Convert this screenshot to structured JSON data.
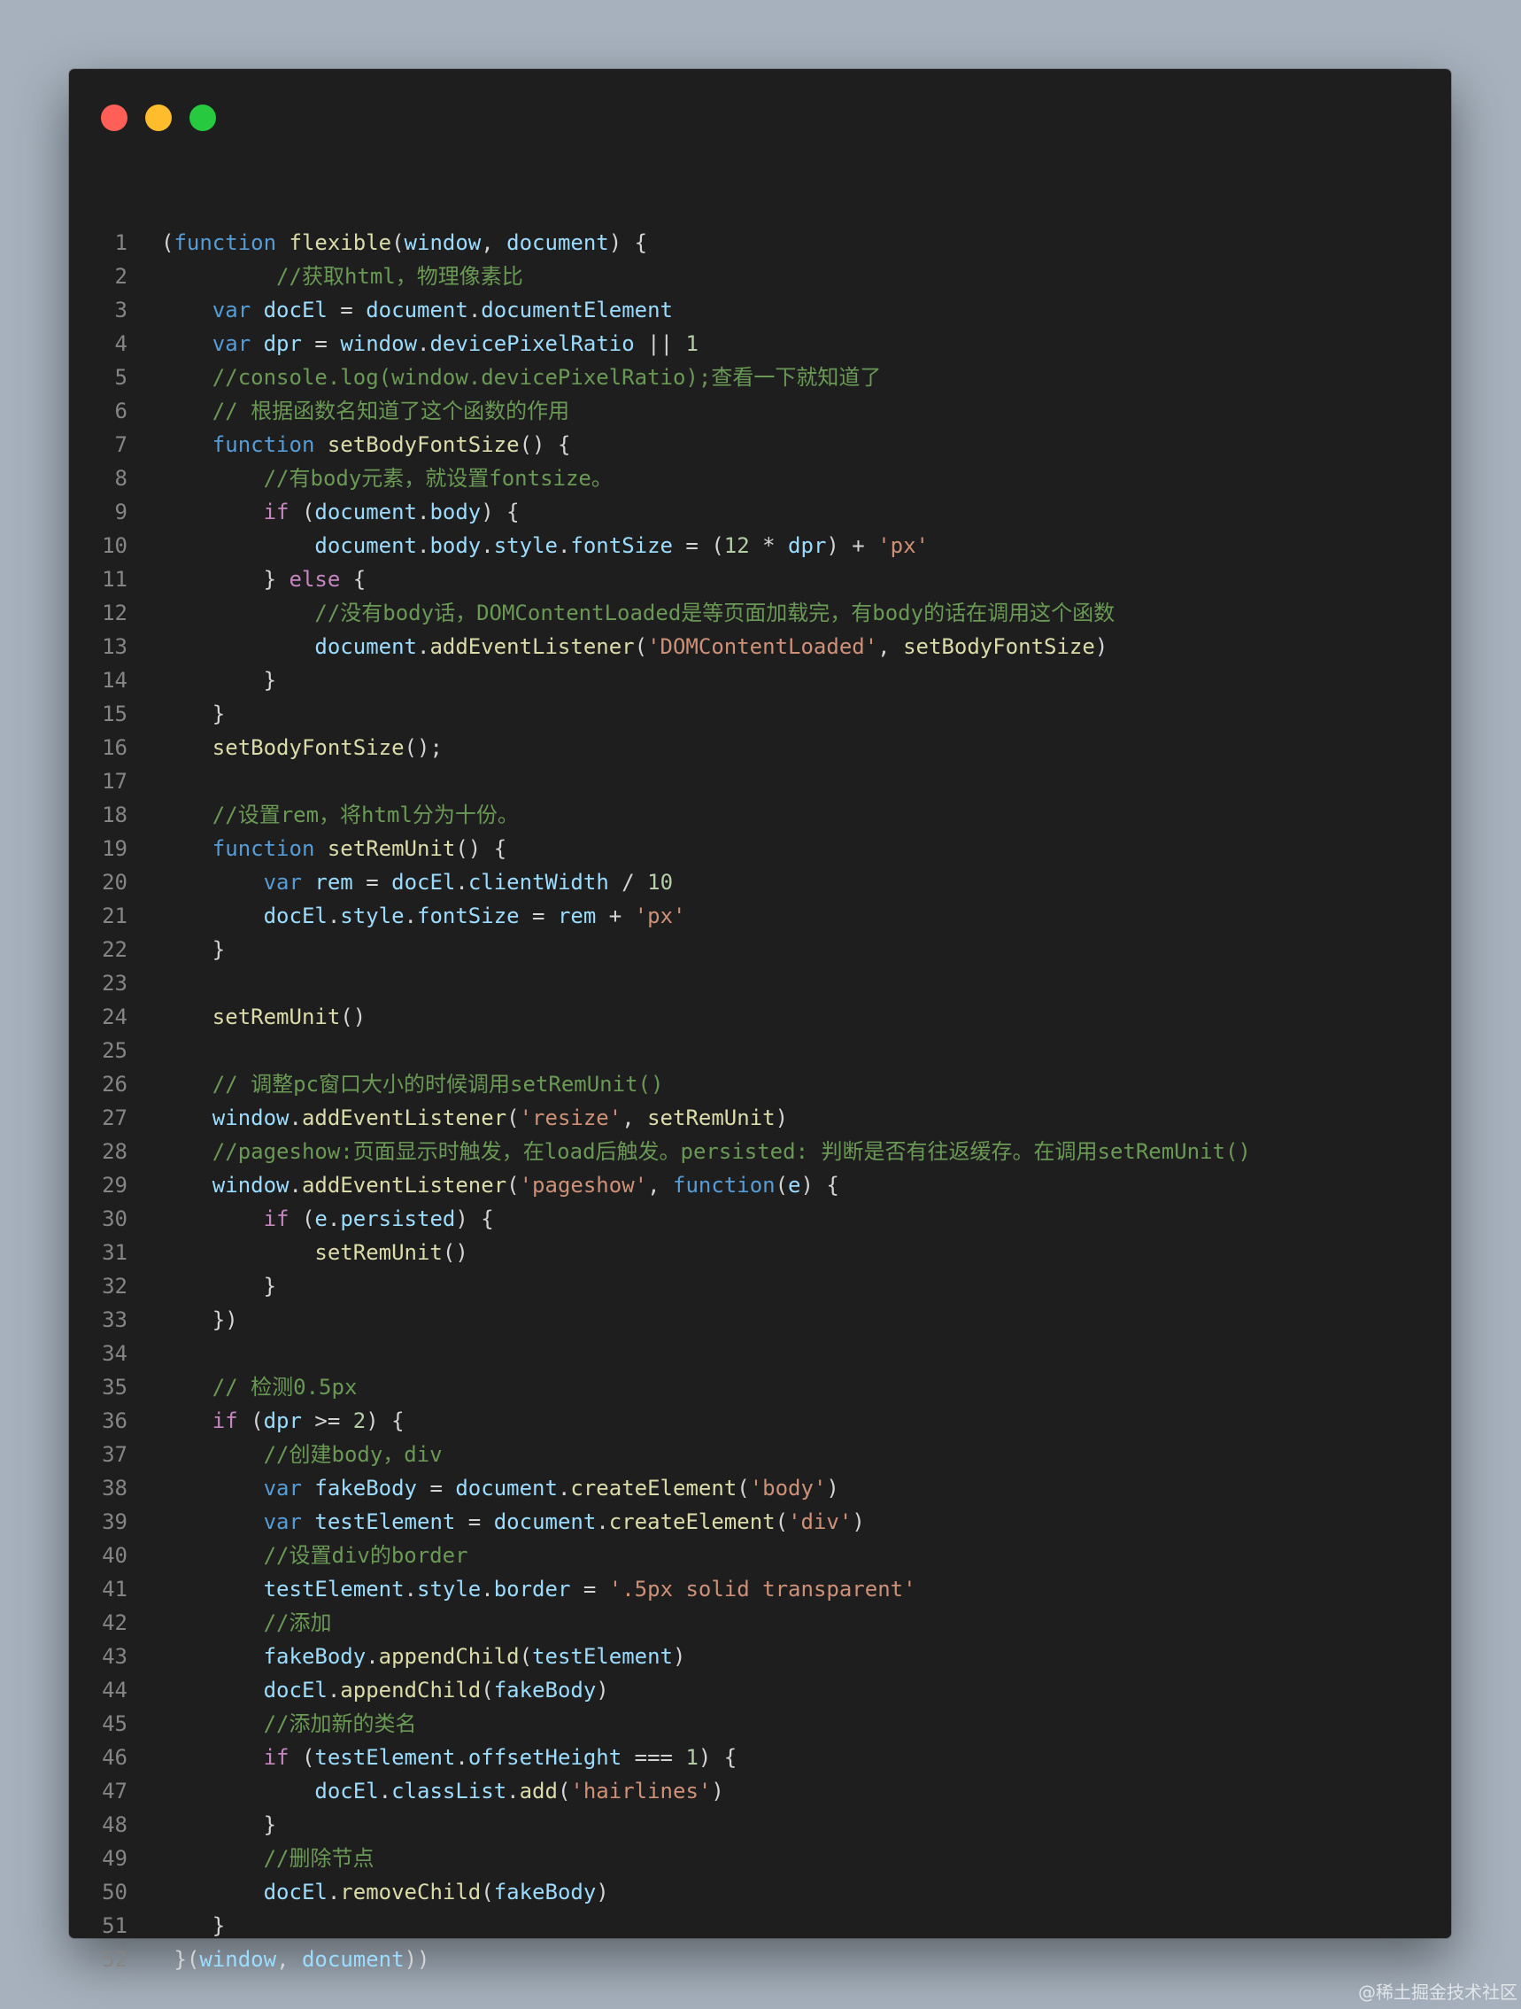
{
  "window": {
    "traffic_lights": [
      {
        "name": "close",
        "color": "#ff5f56"
      },
      {
        "name": "minimize",
        "color": "#ffbd2e"
      },
      {
        "name": "maximize",
        "color": "#27c93f"
      }
    ]
  },
  "code_lines": [
    [
      [
        "p",
        "("
      ],
      [
        "kw",
        "function"
      ],
      [
        "p",
        " "
      ],
      [
        "fn",
        "flexible"
      ],
      [
        "p",
        "("
      ],
      [
        "var",
        "window"
      ],
      [
        "p",
        ", "
      ],
      [
        "var",
        "document"
      ],
      [
        "p",
        ") {"
      ]
    ],
    [
      [
        "p",
        "         "
      ],
      [
        "cmt",
        "//获取html，物理像素比"
      ]
    ],
    [
      [
        "p",
        "    "
      ],
      [
        "kw",
        "var"
      ],
      [
        "p",
        " "
      ],
      [
        "var",
        "docEl"
      ],
      [
        "p",
        " = "
      ],
      [
        "var",
        "document"
      ],
      [
        "p",
        "."
      ],
      [
        "var",
        "documentElement"
      ]
    ],
    [
      [
        "p",
        "    "
      ],
      [
        "kw",
        "var"
      ],
      [
        "p",
        " "
      ],
      [
        "var",
        "dpr"
      ],
      [
        "p",
        " = "
      ],
      [
        "var",
        "window"
      ],
      [
        "p",
        "."
      ],
      [
        "var",
        "devicePixelRatio"
      ],
      [
        "p",
        " || "
      ],
      [
        "num",
        "1"
      ]
    ],
    [
      [
        "p",
        "    "
      ],
      [
        "cmt",
        "//console.log(window.devicePixelRatio);查看一下就知道了"
      ]
    ],
    [
      [
        "p",
        "    "
      ],
      [
        "cmt",
        "// 根据函数名知道了这个函数的作用"
      ]
    ],
    [
      [
        "p",
        "    "
      ],
      [
        "kw",
        "function"
      ],
      [
        "p",
        " "
      ],
      [
        "fn",
        "setBodyFontSize"
      ],
      [
        "p",
        "() {"
      ]
    ],
    [
      [
        "p",
        "        "
      ],
      [
        "cmt",
        "//有body元素，就设置fontsize。"
      ]
    ],
    [
      [
        "p",
        "        "
      ],
      [
        "ctl",
        "if"
      ],
      [
        "p",
        " ("
      ],
      [
        "var",
        "document"
      ],
      [
        "p",
        "."
      ],
      [
        "var",
        "body"
      ],
      [
        "p",
        ") {"
      ]
    ],
    [
      [
        "p",
        "            "
      ],
      [
        "var",
        "document"
      ],
      [
        "p",
        "."
      ],
      [
        "var",
        "body"
      ],
      [
        "p",
        "."
      ],
      [
        "var",
        "style"
      ],
      [
        "p",
        "."
      ],
      [
        "var",
        "fontSize"
      ],
      [
        "p",
        " = ("
      ],
      [
        "num",
        "12"
      ],
      [
        "p",
        " * "
      ],
      [
        "var",
        "dpr"
      ],
      [
        "p",
        ") + "
      ],
      [
        "str",
        "'px'"
      ]
    ],
    [
      [
        "p",
        "        } "
      ],
      [
        "ctl",
        "else"
      ],
      [
        "p",
        " {"
      ]
    ],
    [
      [
        "p",
        "            "
      ],
      [
        "cmt",
        "//没有body话，DOMContentLoaded是等页面加载完，有body的话在调用这个函数"
      ]
    ],
    [
      [
        "p",
        "            "
      ],
      [
        "var",
        "document"
      ],
      [
        "p",
        "."
      ],
      [
        "fn",
        "addEventListener"
      ],
      [
        "p",
        "("
      ],
      [
        "str",
        "'DOMContentLoaded'"
      ],
      [
        "p",
        ", "
      ],
      [
        "fn",
        "setBodyFontSize"
      ],
      [
        "p",
        ")"
      ]
    ],
    [
      [
        "p",
        "        }"
      ]
    ],
    [
      [
        "p",
        "    }"
      ]
    ],
    [
      [
        "p",
        "    "
      ],
      [
        "fn",
        "setBodyFontSize"
      ],
      [
        "p",
        "();"
      ]
    ],
    [],
    [
      [
        "p",
        "    "
      ],
      [
        "cmt",
        "//设置rem，将html分为十份。"
      ]
    ],
    [
      [
        "p",
        "    "
      ],
      [
        "kw",
        "function"
      ],
      [
        "p",
        " "
      ],
      [
        "fn",
        "setRemUnit"
      ],
      [
        "p",
        "() {"
      ]
    ],
    [
      [
        "p",
        "        "
      ],
      [
        "kw",
        "var"
      ],
      [
        "p",
        " "
      ],
      [
        "var",
        "rem"
      ],
      [
        "p",
        " = "
      ],
      [
        "var",
        "docEl"
      ],
      [
        "p",
        "."
      ],
      [
        "var",
        "clientWidth"
      ],
      [
        "p",
        " / "
      ],
      [
        "num",
        "10"
      ]
    ],
    [
      [
        "p",
        "        "
      ],
      [
        "var",
        "docEl"
      ],
      [
        "p",
        "."
      ],
      [
        "var",
        "style"
      ],
      [
        "p",
        "."
      ],
      [
        "var",
        "fontSize"
      ],
      [
        "p",
        " = "
      ],
      [
        "var",
        "rem"
      ],
      [
        "p",
        " + "
      ],
      [
        "str",
        "'px'"
      ]
    ],
    [
      [
        "p",
        "    }"
      ]
    ],
    [],
    [
      [
        "p",
        "    "
      ],
      [
        "fn",
        "setRemUnit"
      ],
      [
        "p",
        "()"
      ]
    ],
    [],
    [
      [
        "p",
        "    "
      ],
      [
        "cmt",
        "// 调整pc窗口大小的时候调用setRemUnit()"
      ]
    ],
    [
      [
        "p",
        "    "
      ],
      [
        "var",
        "window"
      ],
      [
        "p",
        "."
      ],
      [
        "fn",
        "addEventListener"
      ],
      [
        "p",
        "("
      ],
      [
        "str",
        "'resize'"
      ],
      [
        "p",
        ", "
      ],
      [
        "fn",
        "setRemUnit"
      ],
      [
        "p",
        ")"
      ]
    ],
    [
      [
        "p",
        "    "
      ],
      [
        "cmt",
        "//pageshow:页面显示时触发，在load后触发。persisted: 判断是否有往返缓存。在调用setRemUnit()"
      ]
    ],
    [
      [
        "p",
        "    "
      ],
      [
        "var",
        "window"
      ],
      [
        "p",
        "."
      ],
      [
        "fn",
        "addEventListener"
      ],
      [
        "p",
        "("
      ],
      [
        "str",
        "'pageshow'"
      ],
      [
        "p",
        ", "
      ],
      [
        "kw",
        "function"
      ],
      [
        "p",
        "("
      ],
      [
        "var",
        "e"
      ],
      [
        "p",
        ") {"
      ]
    ],
    [
      [
        "p",
        "        "
      ],
      [
        "ctl",
        "if"
      ],
      [
        "p",
        " ("
      ],
      [
        "var",
        "e"
      ],
      [
        "p",
        "."
      ],
      [
        "var",
        "persisted"
      ],
      [
        "p",
        ") {"
      ]
    ],
    [
      [
        "p",
        "            "
      ],
      [
        "fn",
        "setRemUnit"
      ],
      [
        "p",
        "()"
      ]
    ],
    [
      [
        "p",
        "        }"
      ]
    ],
    [
      [
        "p",
        "    })"
      ]
    ],
    [],
    [
      [
        "p",
        "    "
      ],
      [
        "cmt",
        "// 检测0.5px"
      ]
    ],
    [
      [
        "p",
        "    "
      ],
      [
        "ctl",
        "if"
      ],
      [
        "p",
        " ("
      ],
      [
        "var",
        "dpr"
      ],
      [
        "p",
        " >= "
      ],
      [
        "num",
        "2"
      ],
      [
        "p",
        ") {"
      ]
    ],
    [
      [
        "p",
        "        "
      ],
      [
        "cmt",
        "//创建body，div"
      ]
    ],
    [
      [
        "p",
        "        "
      ],
      [
        "kw",
        "var"
      ],
      [
        "p",
        " "
      ],
      [
        "var",
        "fakeBody"
      ],
      [
        "p",
        " = "
      ],
      [
        "var",
        "document"
      ],
      [
        "p",
        "."
      ],
      [
        "fn",
        "createElement"
      ],
      [
        "p",
        "("
      ],
      [
        "str",
        "'body'"
      ],
      [
        "p",
        ")"
      ]
    ],
    [
      [
        "p",
        "        "
      ],
      [
        "kw",
        "var"
      ],
      [
        "p",
        " "
      ],
      [
        "var",
        "testElement"
      ],
      [
        "p",
        " = "
      ],
      [
        "var",
        "document"
      ],
      [
        "p",
        "."
      ],
      [
        "fn",
        "createElement"
      ],
      [
        "p",
        "("
      ],
      [
        "str",
        "'div'"
      ],
      [
        "p",
        ")"
      ]
    ],
    [
      [
        "p",
        "        "
      ],
      [
        "cmt",
        "//设置div的border"
      ]
    ],
    [
      [
        "p",
        "        "
      ],
      [
        "var",
        "testElement"
      ],
      [
        "p",
        "."
      ],
      [
        "var",
        "style"
      ],
      [
        "p",
        "."
      ],
      [
        "var",
        "border"
      ],
      [
        "p",
        " = "
      ],
      [
        "str",
        "'.5px solid transparent'"
      ]
    ],
    [
      [
        "p",
        "        "
      ],
      [
        "cmt",
        "//添加"
      ]
    ],
    [
      [
        "p",
        "        "
      ],
      [
        "var",
        "fakeBody"
      ],
      [
        "p",
        "."
      ],
      [
        "fn",
        "appendChild"
      ],
      [
        "p",
        "("
      ],
      [
        "var",
        "testElement"
      ],
      [
        "p",
        ")"
      ]
    ],
    [
      [
        "p",
        "        "
      ],
      [
        "var",
        "docEl"
      ],
      [
        "p",
        "."
      ],
      [
        "fn",
        "appendChild"
      ],
      [
        "p",
        "("
      ],
      [
        "var",
        "fakeBody"
      ],
      [
        "p",
        ")"
      ]
    ],
    [
      [
        "p",
        "        "
      ],
      [
        "cmt",
        "//添加新的类名"
      ]
    ],
    [
      [
        "p",
        "        "
      ],
      [
        "ctl",
        "if"
      ],
      [
        "p",
        " ("
      ],
      [
        "var",
        "testElement"
      ],
      [
        "p",
        "."
      ],
      [
        "var",
        "offsetHeight"
      ],
      [
        "p",
        " === "
      ],
      [
        "num",
        "1"
      ],
      [
        "p",
        ") {"
      ]
    ],
    [
      [
        "p",
        "            "
      ],
      [
        "var",
        "docEl"
      ],
      [
        "p",
        "."
      ],
      [
        "var",
        "classList"
      ],
      [
        "p",
        "."
      ],
      [
        "fn",
        "add"
      ],
      [
        "p",
        "("
      ],
      [
        "str",
        "'hairlines'"
      ],
      [
        "p",
        ")"
      ]
    ],
    [
      [
        "p",
        "        }"
      ]
    ],
    [
      [
        "p",
        "        "
      ],
      [
        "cmt",
        "//删除节点"
      ]
    ],
    [
      [
        "p",
        "        "
      ],
      [
        "var",
        "docEl"
      ],
      [
        "p",
        "."
      ],
      [
        "fn",
        "removeChild"
      ],
      [
        "p",
        "("
      ],
      [
        "var",
        "fakeBody"
      ],
      [
        "p",
        ")"
      ]
    ],
    [
      [
        "p",
        "    }"
      ]
    ],
    [
      [
        "p",
        " }("
      ],
      [
        "var",
        "window"
      ],
      [
        "p",
        ", "
      ],
      [
        "var",
        "document"
      ],
      [
        "p",
        "))"
      ]
    ]
  ],
  "watermark": "@稀土掘金技术社区"
}
